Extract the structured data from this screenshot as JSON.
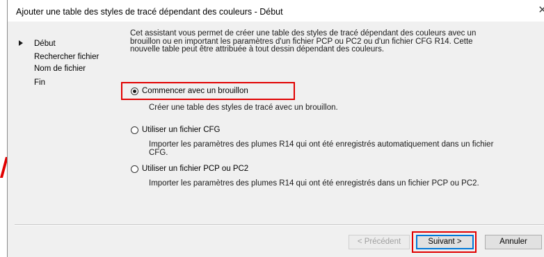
{
  "window": {
    "title": "Ajouter une table des styles de tracé dépendant des couleurs - Début",
    "close_glyph": "✕"
  },
  "nav": {
    "items": [
      {
        "label": "Début",
        "current": true
      },
      {
        "label": "Rechercher fichier",
        "current": false
      },
      {
        "label": "Nom de fichier",
        "current": false
      },
      {
        "label": "Fin",
        "current": false
      }
    ]
  },
  "intro": "Cet assistant vous permet de créer une table des styles de tracé dépendant des couleurs avec un brouillon ou en important les paramètres d'un fichier PCP ou PC2 ou d'un fichier CFG R14. Cette nouvelle table peut être attribuée à tout dessin dépendant des couleurs.",
  "options": [
    {
      "label": "Commencer avec un brouillon",
      "description": "Créer une table des styles de tracé avec un brouillon.",
      "selected": true
    },
    {
      "label": "Utiliser un fichier CFG",
      "description": "Importer les paramètres des plumes R14 qui ont été enregistrés automatiquement dans un fichier CFG.",
      "selected": false
    },
    {
      "label": "Utiliser un fichier PCP ou PC2",
      "description": "Importer les paramètres des plumes R14 qui ont été enregistrés dans un fichier PCP ou PC2.",
      "selected": false
    }
  ],
  "buttons": {
    "previous": "< Précédent",
    "next": "Suivant >",
    "cancel": "Annuler"
  },
  "colors": {
    "highlight": "#e10000",
    "dialog_bg": "#f0f0f0",
    "focus_border": "#0078d7"
  }
}
